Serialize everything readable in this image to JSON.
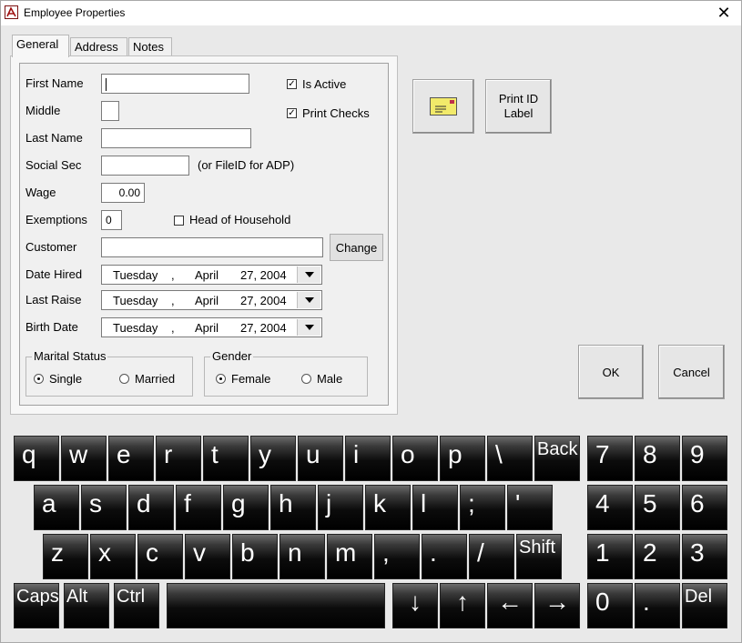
{
  "window": {
    "title": "Employee Properties",
    "close_glyph": "✕"
  },
  "tabs": [
    {
      "label": "General",
      "active": true
    },
    {
      "label": "Address",
      "active": false
    },
    {
      "label": "Notes",
      "active": false
    }
  ],
  "form": {
    "first_name": {
      "label": "First Name",
      "value": ""
    },
    "middle": {
      "label": "Middle",
      "value": ""
    },
    "last_name": {
      "label": "Last Name",
      "value": ""
    },
    "social_sec": {
      "label": "Social Sec",
      "value": "",
      "hint": "(or FileID for ADP)"
    },
    "wage": {
      "label": "Wage",
      "value": "0.00"
    },
    "exemptions": {
      "label": "Exemptions",
      "value": "0"
    },
    "head_of_household": {
      "label": "Head of Household",
      "checked": false
    },
    "is_active": {
      "label": "Is Active",
      "checked": true
    },
    "print_checks": {
      "label": "Print Checks",
      "checked": true
    },
    "customer": {
      "label": "Customer",
      "value": "",
      "change_label": "Change"
    },
    "date_hired": {
      "label": "Date Hired",
      "weekday": "Tuesday",
      "month": "April",
      "day_year": "27, 2004"
    },
    "last_raise": {
      "label": "Last Raise",
      "weekday": "Tuesday",
      "month": "April",
      "day_year": "27, 2004"
    },
    "birth_date": {
      "label": "Birth Date",
      "weekday": "Tuesday",
      "month": "April",
      "day_year": "27, 2004"
    },
    "marital_status": {
      "label": "Marital Status",
      "options": [
        "Single",
        "Married"
      ],
      "selected": "Single"
    },
    "gender": {
      "label": "Gender",
      "options": [
        "Female",
        "Male"
      ],
      "selected": "Female"
    }
  },
  "side_buttons": {
    "print_id_label": "Print ID\nLabel",
    "ok": "OK",
    "cancel": "Cancel"
  },
  "keyboard": {
    "row1": [
      "q",
      "w",
      "e",
      "r",
      "t",
      "y",
      "u",
      "i",
      "o",
      "p",
      "\\",
      "Back"
    ],
    "row2": [
      "a",
      "s",
      "d",
      "f",
      "g",
      "h",
      "j",
      "k",
      "l",
      ";",
      "'"
    ],
    "row3": [
      "z",
      "x",
      "c",
      "v",
      "b",
      "n",
      "m",
      ",",
      ".",
      "/",
      "Shift"
    ],
    "row4": [
      "Caps",
      "Alt",
      "Ctrl"
    ],
    "arrows": [
      "↓",
      "↑",
      "←",
      "→"
    ],
    "numpad": [
      "7",
      "8",
      "9",
      "4",
      "5",
      "6",
      "1",
      "2",
      "3",
      "0",
      ".",
      "Del"
    ]
  }
}
